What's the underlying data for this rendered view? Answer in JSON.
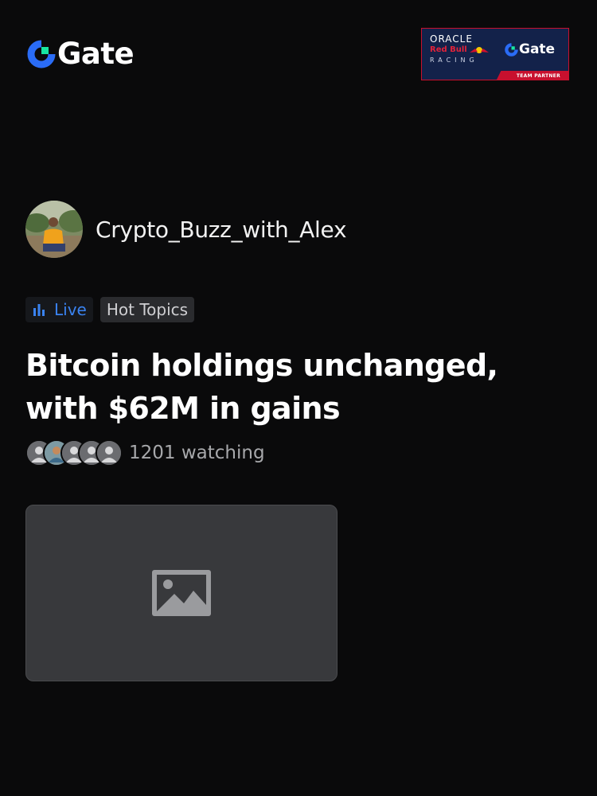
{
  "brand": {
    "name": "Gate"
  },
  "partner_banner": {
    "oracle": "ORACLE",
    "redbull": "Red Bull",
    "racing": "RACING",
    "gate": "Gate",
    "strip": "TEAM PARTNER"
  },
  "author": {
    "name": "Crypto_Buzz_with_Alex"
  },
  "tags": {
    "live": "Live",
    "hot": "Hot Topics"
  },
  "post": {
    "title": "Bitcoin holdings unchanged, with $62M in gains",
    "watching_count": "1201",
    "watching_label": "watching"
  },
  "colors": {
    "accent_blue": "#3a83f1",
    "brand_green": "#17e6a1",
    "background": "#0a0a0b"
  },
  "icons": {
    "live": "bar-chart-icon",
    "media": "image-placeholder-icon"
  }
}
